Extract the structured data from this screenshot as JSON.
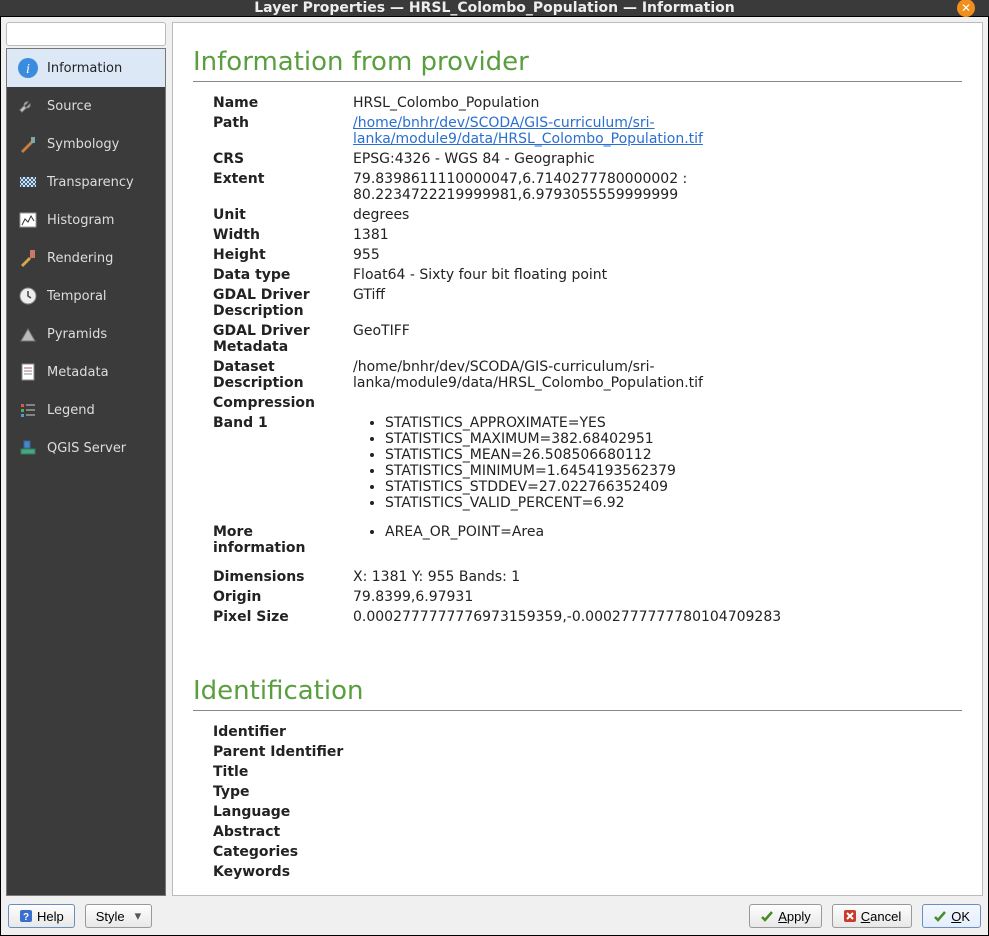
{
  "window": {
    "title": "Layer Properties — HRSL_Colombo_Population — Information"
  },
  "sidebar": {
    "items": [
      {
        "label": "Information",
        "selected": true
      },
      {
        "label": "Source"
      },
      {
        "label": "Symbology"
      },
      {
        "label": "Transparency"
      },
      {
        "label": "Histogram"
      },
      {
        "label": "Rendering"
      },
      {
        "label": "Temporal"
      },
      {
        "label": "Pyramids"
      },
      {
        "label": "Metadata"
      },
      {
        "label": "Legend"
      },
      {
        "label": "QGIS Server"
      }
    ]
  },
  "sections": {
    "provider": {
      "title": "Information from provider"
    },
    "ident": {
      "title": "Identification"
    }
  },
  "info": {
    "name": {
      "label": "Name",
      "value": "HRSL_Colombo_Population"
    },
    "path": {
      "label": "Path",
      "value": "/home/bnhr/dev/SCODA/GIS-curriculum/sri-lanka/module9/data/HRSL_Colombo_Population.tif"
    },
    "crs": {
      "label": "CRS",
      "value": "EPSG:4326 - WGS 84 - Geographic"
    },
    "extent": {
      "label": "Extent",
      "value": "79.8398611110000047,6.7140277780000002 : 80.2234722219999981,6.9793055559999999"
    },
    "unit": {
      "label": "Unit",
      "value": "degrees"
    },
    "width": {
      "label": "Width",
      "value": "1381"
    },
    "height": {
      "label": "Height",
      "value": "955"
    },
    "datatype": {
      "label": "Data type",
      "value": "Float64 - Sixty four bit floating point"
    },
    "gdal_drv_desc": {
      "label": "GDAL Driver Description",
      "value": "GTiff"
    },
    "gdal_drv_meta": {
      "label": "GDAL Driver Metadata",
      "value": "GeoTIFF"
    },
    "dataset_desc": {
      "label": "Dataset Description",
      "value": "/home/bnhr/dev/SCODA/GIS-curriculum/sri-lanka/module9/data/HRSL_Colombo_Population.tif"
    },
    "compression": {
      "label": "Compression",
      "value": ""
    },
    "band1": {
      "label": "Band 1",
      "items": [
        "STATISTICS_APPROXIMATE=YES",
        "STATISTICS_MAXIMUM=382.68402951",
        "STATISTICS_MEAN=26.508506680112",
        "STATISTICS_MINIMUM=1.6454193562379",
        "STATISTICS_STDDEV=27.022766352409",
        "STATISTICS_VALID_PERCENT=6.92"
      ]
    },
    "moreinfo": {
      "label": "More information",
      "items": [
        "AREA_OR_POINT=Area"
      ]
    },
    "dimensions": {
      "label": "Dimensions",
      "value": "X: 1381 Y: 955 Bands: 1"
    },
    "origin": {
      "label": "Origin",
      "value": "79.8399,6.97931"
    },
    "pixelsize": {
      "label": "Pixel Size",
      "value": "0.0002777777776973159359,-0.0002777777780104709283"
    }
  },
  "ident": {
    "identifier": {
      "label": "Identifier"
    },
    "parent": {
      "label": "Parent Identifier"
    },
    "title": {
      "label": "Title"
    },
    "type": {
      "label": "Type"
    },
    "language": {
      "label": "Language"
    },
    "abstract": {
      "label": "Abstract"
    },
    "categories": {
      "label": "Categories"
    },
    "keywords": {
      "label": "Keywords"
    }
  },
  "buttons": {
    "help": "Help",
    "style": "Style",
    "apply": "Apply",
    "cancel": "Cancel",
    "ok": "OK"
  }
}
